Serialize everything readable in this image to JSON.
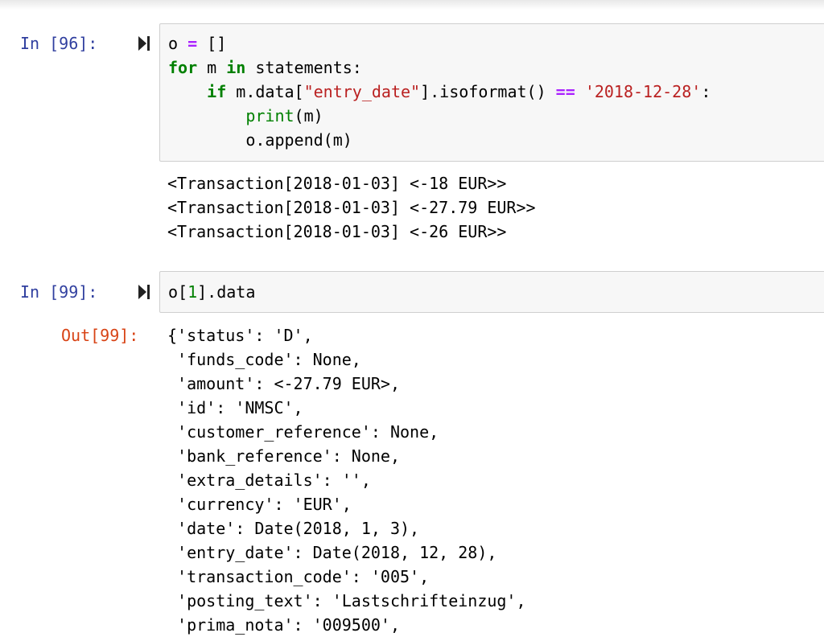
{
  "cells": [
    {
      "prompt": "In [96]:",
      "code": [
        [
          {
            "t": "o "
          },
          {
            "t": "=",
            "c": "op"
          },
          {
            "t": " []"
          }
        ],
        [
          {
            "t": "for",
            "c": "kw"
          },
          {
            "t": " m "
          },
          {
            "t": "in",
            "c": "kw"
          },
          {
            "t": " statements:"
          }
        ],
        [
          {
            "t": "    "
          },
          {
            "t": "if",
            "c": "kw"
          },
          {
            "t": " m.data["
          },
          {
            "t": "\"entry_date\"",
            "c": "str"
          },
          {
            "t": "].isoformat() "
          },
          {
            "t": "==",
            "c": "op"
          },
          {
            "t": " "
          },
          {
            "t": "'2018-12-28'",
            "c": "str"
          },
          {
            "t": ":"
          }
        ],
        [
          {
            "t": "        "
          },
          {
            "t": "print",
            "c": "bi"
          },
          {
            "t": "(m)"
          }
        ],
        [
          {
            "t": "        o.append(m)"
          }
        ]
      ],
      "stdout": [
        "<Transaction[2018-01-03] <-18 EUR>>",
        "<Transaction[2018-01-03] <-27.79 EUR>>",
        "<Transaction[2018-01-03] <-26 EUR>>"
      ]
    },
    {
      "prompt": "In [99]:",
      "code": [
        [
          {
            "t": "o["
          },
          {
            "t": "1",
            "c": "num"
          },
          {
            "t": "].data"
          }
        ]
      ],
      "out_prompt": "Out[99]:",
      "output": [
        "{'status': 'D',",
        " 'funds_code': None,",
        " 'amount': <-27.79 EUR>,",
        " 'id': 'NMSC',",
        " 'customer_reference': None,",
        " 'bank_reference': None,",
        " 'extra_details': '',",
        " 'currency': 'EUR',",
        " 'date': Date(2018, 1, 3),",
        " 'entry_date': Date(2018, 12, 28),",
        " 'transaction_code': '005',",
        " 'posting_text': 'Lastschrifteinzug',",
        " 'prima_nota': '009500',"
      ]
    }
  ],
  "icons": {
    "run": "run-cell-icon"
  },
  "colors": {
    "in_prompt": "#303f9f",
    "out_prompt": "#d84315",
    "keyword": "#008000",
    "operator": "#aa22ff",
    "string": "#ba2121"
  }
}
